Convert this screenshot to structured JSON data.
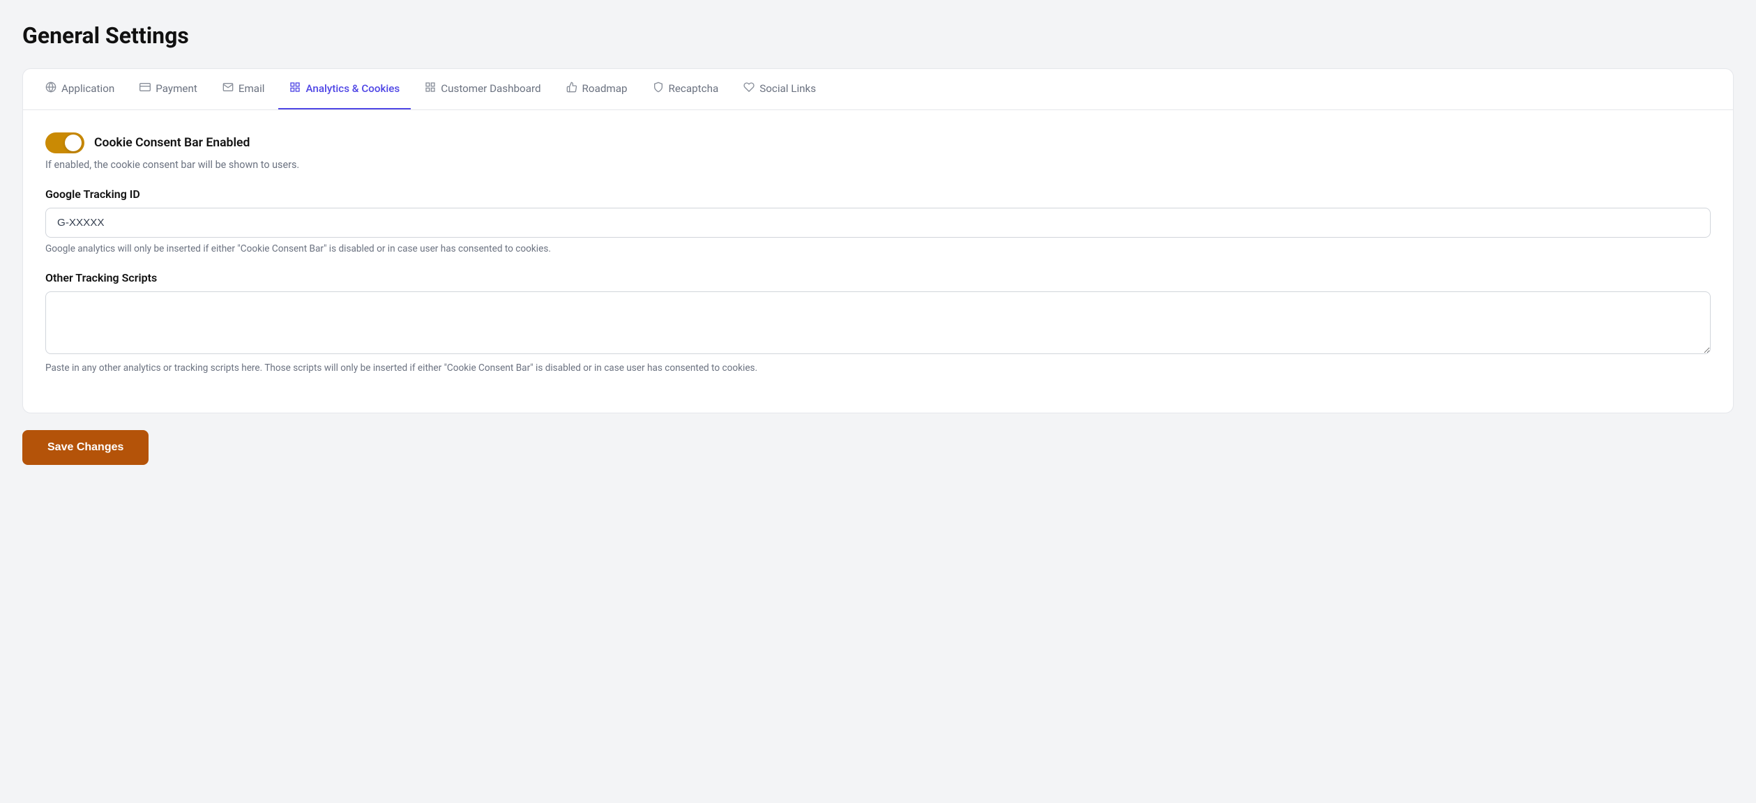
{
  "page": {
    "title": "General Settings"
  },
  "tabs": [
    {
      "id": "application",
      "label": "Application",
      "icon": "🌐",
      "active": false
    },
    {
      "id": "payment",
      "label": "Payment",
      "icon": "💳",
      "active": false
    },
    {
      "id": "email",
      "label": "Email",
      "icon": "✉️",
      "active": false
    },
    {
      "id": "analytics",
      "label": "Analytics & Cookies",
      "icon": "⊞",
      "active": true
    },
    {
      "id": "customer-dashboard",
      "label": "Customer Dashboard",
      "icon": "⊞",
      "active": false
    },
    {
      "id": "roadmap",
      "label": "Roadmap",
      "icon": "🎮",
      "active": false
    },
    {
      "id": "recaptcha",
      "label": "Recaptcha",
      "icon": "🛡",
      "active": false
    },
    {
      "id": "social-links",
      "label": "Social Links",
      "icon": "♡",
      "active": false
    }
  ],
  "form": {
    "toggle": {
      "label": "Cookie Consent Bar Enabled",
      "description": "If enabled, the cookie consent bar will be shown to users.",
      "enabled": true
    },
    "google_tracking": {
      "label": "Google Tracking ID",
      "value": "G-XXXXX",
      "placeholder": "G-XXXXX",
      "hint": "Google analytics will only be inserted if either \"Cookie Consent Bar\" is disabled or in case user has consented to cookies."
    },
    "other_tracking": {
      "label": "Other Tracking Scripts",
      "value": "",
      "placeholder": "",
      "hint": "Paste in any other analytics or tracking scripts here. Those scripts will only be inserted if either \"Cookie Consent Bar\" is disabled or in case user has consented to cookies."
    }
  },
  "buttons": {
    "save": "Save Changes"
  }
}
